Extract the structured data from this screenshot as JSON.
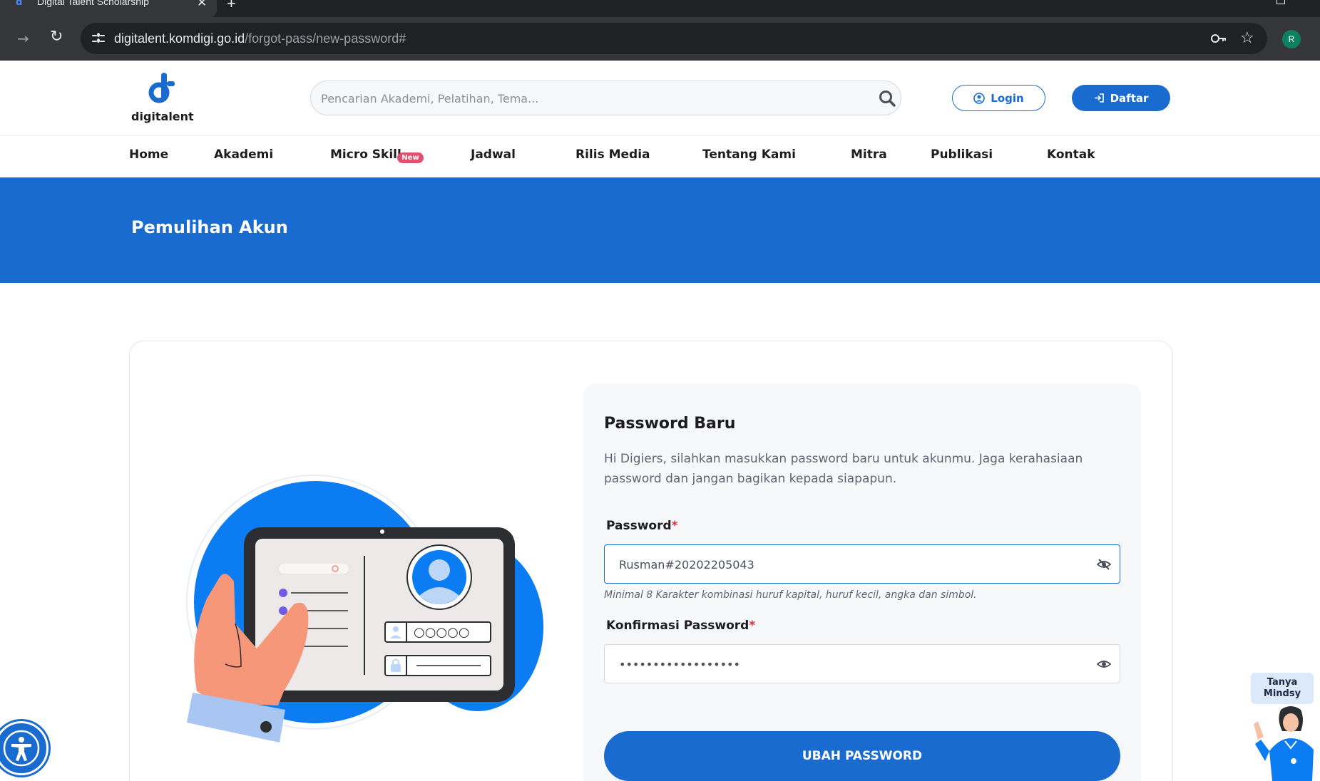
{
  "browser": {
    "tab_title": "Digital Talent Scholarship",
    "tab_close": "✕",
    "new_tab": "+",
    "url_host": "digitalent.komdigi.go.id",
    "url_path": "/forgot-pass/new-password#",
    "profile_initial": "R"
  },
  "header": {
    "logo_text": "digitalent",
    "search_placeholder": "Pencarian Akademi, Pelatihan, Tema...",
    "login_label": "Login",
    "register_label": "Daftar"
  },
  "nav": {
    "items": [
      {
        "label": "Home"
      },
      {
        "label": "Akademi"
      },
      {
        "label": "Micro Skill",
        "badge": "New"
      },
      {
        "label": "Jadwal"
      },
      {
        "label": "Rilis Media"
      },
      {
        "label": "Tentang Kami"
      },
      {
        "label": "Mitra"
      },
      {
        "label": "Publikasi"
      },
      {
        "label": "Kontak"
      }
    ]
  },
  "banner": {
    "title": "Pemulihan Akun"
  },
  "form": {
    "title": "Password Baru",
    "description": "Hi Digiers, silahkan masukkan password baru untuk akunmu. Jaga kerahasiaan password dan jangan bagikan kepada siapapun.",
    "password_label": "Password",
    "password_value": "Rusman#20202205043",
    "password_hint": "Minimal 8 Karakter kombinasi huruf kapital, huruf kecil, angka dan simbol.",
    "confirm_label": "Konfirmasi Password",
    "confirm_value": "••••••••••••••••••",
    "required_mark": "*",
    "submit_label": "UBAH PASSWORD"
  },
  "illustration": {
    "pin_dots": "○○○○○"
  },
  "chat": {
    "label_line1": "Tanya",
    "label_line2": "Mindsy"
  },
  "colors": {
    "brand_blue": "#1a6bd0",
    "badge_red": "#e14f6e",
    "required_red": "#e02e3c"
  },
  "icons": [
    "site-info-icon",
    "key-icon",
    "star-icon",
    "search-icon",
    "user-circle-icon",
    "sign-in-icon",
    "eye-slash-icon",
    "eye-icon",
    "accessibility-icon"
  ]
}
